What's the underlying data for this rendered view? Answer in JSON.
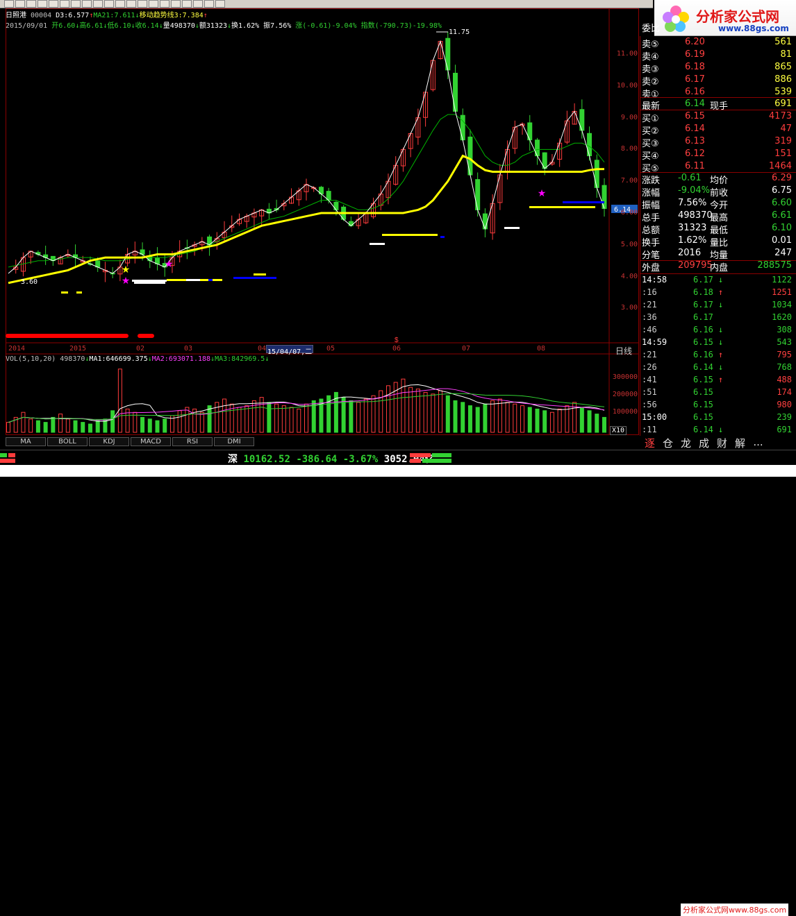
{
  "header": {
    "line1": [
      {
        "text": "日照港",
        "color": "#ffffff"
      },
      {
        "text": " 00004",
        "color": "#c0c0c0"
      },
      {
        "text": " D3:6.577",
        "color": "#ffffff"
      },
      {
        "text": "↑",
        "color": "#ff4040"
      },
      {
        "text": "MA21:7.611",
        "color": "#32d232"
      },
      {
        "text": "↓",
        "color": "#32d232"
      },
      {
        "text": "移动趋势线3:7.384",
        "color": "#ffff40"
      },
      {
        "text": "↑",
        "color": "#ff4040"
      }
    ],
    "line2": [
      {
        "text": "2015/09/01",
        "color": "#c0c0c0"
      },
      {
        "text": " 开6.60",
        "color": "#32d232"
      },
      {
        "text": "↓",
        "color": "#32d232"
      },
      {
        "text": "高6.61",
        "color": "#32d232"
      },
      {
        "text": "↓",
        "color": "#32d232"
      },
      {
        "text": "低6.10",
        "color": "#32d232"
      },
      {
        "text": "↓",
        "color": "#32d232"
      },
      {
        "text": "收6.14",
        "color": "#32d232"
      },
      {
        "text": "↓",
        "color": "#32d232"
      },
      {
        "text": "量498370",
        "color": "#ffffff"
      },
      {
        "text": "↓",
        "color": "#32d232"
      },
      {
        "text": "额31323",
        "color": "#ffffff"
      },
      {
        "text": "↓",
        "color": "#32d232"
      },
      {
        "text": "换1.62%",
        "color": "#ffffff"
      },
      {
        "text": " 振7.56%",
        "color": "#ffffff"
      },
      {
        "text": " 涨(-0.61)-9.04%",
        "color": "#32d232"
      },
      {
        "text": " 指数(-790.73)-19.98%",
        "color": "#32d232"
      }
    ]
  },
  "chart_data": {
    "type": "candlestick",
    "y_ticks": [
      "11.00",
      "10.00",
      "9.00",
      "8.00",
      "7.00",
      "6.00",
      "5.00",
      "4.00",
      "3.00"
    ],
    "x_labels": [
      "2014",
      "2015",
      "02",
      "03",
      "04",
      "05",
      "06",
      "07",
      "08"
    ],
    "highlight_date": "15/04/07,二",
    "max_label": "11.75",
    "min_label": "3.60",
    "current_price_tag": "6.14",
    "period_label": "日线",
    "volume_ticks": [
      "300000",
      "200000",
      "100000"
    ],
    "volume_scale": "X10",
    "close_series": [
      4.1,
      4.3,
      4.6,
      4.8,
      4.7,
      4.6,
      4.5,
      4.6,
      4.7,
      4.6,
      4.5,
      4.4,
      4.3,
      4.2,
      4.1,
      4.3,
      4.7,
      4.8,
      4.7,
      4.5,
      4.4,
      4.3,
      4.6,
      4.8,
      4.9,
      5.0,
      5.1,
      5.0,
      5.2,
      5.4,
      5.6,
      5.8,
      5.9,
      6.0,
      6.1,
      6.0,
      6.1,
      6.3,
      6.5,
      6.7,
      6.9,
      6.8,
      6.6,
      6.4,
      6.1,
      5.8,
      5.6,
      5.8,
      6.0,
      6.3,
      6.6,
      7.0,
      7.5,
      8.0,
      8.5,
      9.0,
      9.8,
      10.8,
      11.4,
      10.5,
      9.2,
      8.3,
      7.2,
      6.1,
      5.5,
      6.3,
      7.2,
      8.0,
      8.7,
      8.8,
      8.3,
      7.8,
      7.4,
      7.6,
      8.2,
      8.9,
      9.2,
      8.6,
      7.8,
      6.8,
      6.14
    ],
    "ma21_series": [
      4.3,
      4.35,
      4.4,
      4.45,
      4.5,
      4.5,
      4.55,
      4.55,
      4.6,
      4.6,
      4.6,
      4.6,
      4.55,
      4.5,
      4.5,
      4.5,
      4.55,
      4.6,
      4.6,
      4.6,
      4.6,
      4.6,
      4.65,
      4.7,
      4.75,
      4.8,
      4.9,
      5.0,
      5.1,
      5.2,
      5.3,
      5.4,
      5.5,
      5.6,
      5.7,
      5.8,
      5.85,
      5.9,
      6.0,
      6.1,
      6.2,
      6.3,
      6.4,
      6.4,
      6.4,
      6.3,
      6.2,
      6.1,
      6.1,
      6.15,
      6.25,
      6.45,
      6.7,
      7.0,
      7.4,
      7.8,
      8.2,
      8.6,
      8.95,
      9.1,
      9.1,
      8.9,
      8.6,
      8.2,
      7.8,
      7.6,
      7.5,
      7.5,
      7.6,
      7.8,
      7.9,
      8.0,
      8.0,
      8.0,
      8.0,
      8.1,
      8.2,
      8.2,
      8.1,
      7.9,
      7.6
    ],
    "trend_series": [
      3.8,
      3.85,
      3.9,
      3.95,
      4.0,
      4.05,
      4.1,
      4.15,
      4.2,
      4.3,
      4.4,
      4.5,
      4.55,
      4.6,
      4.6,
      4.6,
      4.6,
      4.6,
      4.6,
      4.65,
      4.7,
      4.7,
      4.7,
      4.75,
      4.8,
      4.85,
      4.9,
      4.95,
      5.0,
      5.1,
      5.2,
      5.3,
      5.4,
      5.5,
      5.6,
      5.65,
      5.7,
      5.75,
      5.8,
      5.85,
      5.9,
      5.95,
      6.0,
      6.0,
      6.0,
      6.0,
      6.0,
      6.0,
      6.0,
      6.0,
      6.0,
      6.0,
      6.0,
      6.0,
      6.05,
      6.1,
      6.2,
      6.4,
      6.7,
      7.0,
      7.4,
      7.8,
      7.7,
      7.5,
      7.35,
      7.3,
      7.3,
      7.3,
      7.3,
      7.3,
      7.3,
      7.3,
      7.3,
      7.3,
      7.3,
      7.3,
      7.3,
      7.3,
      7.35,
      7.38,
      7.384
    ],
    "volume_series": [
      60,
      90,
      120,
      80,
      70,
      60,
      90,
      110,
      80,
      70,
      60,
      50,
      70,
      80,
      130,
      380,
      140,
      120,
      90,
      80,
      70,
      80,
      100,
      130,
      150,
      140,
      120,
      160,
      180,
      200,
      170,
      150,
      160,
      190,
      210,
      180,
      170,
      160,
      150,
      140,
      170,
      190,
      200,
      220,
      240,
      210,
      190,
      180,
      200,
      220,
      250,
      280,
      300,
      320,
      270,
      260,
      240,
      230,
      250,
      220,
      190,
      180,
      160,
      150,
      170,
      190,
      200,
      180,
      170,
      160,
      150,
      140,
      130,
      120,
      140,
      160,
      180,
      150,
      130,
      110,
      90
    ]
  },
  "vol_info": [
    {
      "text": "VOL(5,10,20) 498370",
      "color": "#c0c0c0"
    },
    {
      "text": "↓",
      "color": "#32d232"
    },
    {
      "text": "MA1:646699.375",
      "color": "#ffffff"
    },
    {
      "text": "↓",
      "color": "#32d232"
    },
    {
      "text": "MA2:693071.188",
      "color": "#ff40ff"
    },
    {
      "text": "↓",
      "color": "#32d232"
    },
    {
      "text": "MA3:842969.5",
      "color": "#32d232"
    },
    {
      "text": "↓",
      "color": "#32d232"
    }
  ],
  "tabs": [
    "MA",
    "BOLL",
    "KDJ",
    "MACD",
    "RSI",
    "DMI"
  ],
  "quote_panel": {
    "weibi_label": "委比",
    "asks": [
      {
        "label": "卖⑤",
        "price": "6.20",
        "vol": "561"
      },
      {
        "label": "卖④",
        "price": "6.19",
        "vol": "81"
      },
      {
        "label": "卖③",
        "price": "6.18",
        "vol": "865"
      },
      {
        "label": "卖②",
        "price": "6.17",
        "vol": "886"
      },
      {
        "label": "卖①",
        "price": "6.16",
        "vol": "539"
      }
    ],
    "last": {
      "label": "最新",
      "price": "6.14",
      "label2": "现手",
      "vol": "691"
    },
    "bids": [
      {
        "label": "买①",
        "price": "6.15",
        "vol": "4173"
      },
      {
        "label": "买②",
        "price": "6.14",
        "vol": "47"
      },
      {
        "label": "买③",
        "price": "6.13",
        "vol": "319"
      },
      {
        "label": "买④",
        "price": "6.12",
        "vol": "151"
      },
      {
        "label": "买⑤",
        "price": "6.11",
        "vol": "1464"
      }
    ],
    "stats": [
      {
        "l1": "涨跌",
        "v1": "-0.61",
        "c1": "#32d232",
        "l2": "均价",
        "v2": "6.29",
        "c2": "#ff4040"
      },
      {
        "l1": "涨幅",
        "v1": "-9.04%",
        "c1": "#32d232",
        "l2": "前收",
        "v2": "6.75",
        "c2": "#ffffff"
      },
      {
        "l1": "振幅",
        "v1": "7.56%",
        "c1": "#ffffff",
        "l2": "今开",
        "v2": "6.60",
        "c2": "#32d232"
      },
      {
        "l1": "总手",
        "v1": "498370",
        "c1": "#ffffff",
        "l2": "最高",
        "v2": "6.61",
        "c2": "#32d232"
      },
      {
        "l1": "总额",
        "v1": "31323",
        "c1": "#ffffff",
        "l2": "最低",
        "v2": "6.10",
        "c2": "#32d232"
      },
      {
        "l1": "换手",
        "v1": "1.62%",
        "c1": "#ffffff",
        "l2": "量比",
        "v2": "0.01",
        "c2": "#ffffff"
      },
      {
        "l1": "分笔",
        "v1": "2016",
        "c1": "#ffffff",
        "l2": "均量",
        "v2": "247",
        "c2": "#ffffff"
      }
    ],
    "outer": {
      "l1": "外盘",
      "v1": "209795",
      "l2": "内盘",
      "v2": "288575"
    }
  },
  "ticks": [
    {
      "time": "14:58",
      "price": "6.17",
      "dir": "↓",
      "vol": "1122",
      "pc": "#32d232",
      "vc": "#32d232"
    },
    {
      "time": ":16",
      "price": "6.18",
      "dir": "↑",
      "vol": "1251",
      "pc": "#32d232",
      "vc": "#ff4040"
    },
    {
      "time": ":21",
      "price": "6.17",
      "dir": "↓",
      "vol": "1034",
      "pc": "#32d232",
      "vc": "#32d232"
    },
    {
      "time": ":36",
      "price": "6.17",
      "dir": "",
      "vol": "1620",
      "pc": "#32d232",
      "vc": "#32d232"
    },
    {
      "time": ":46",
      "price": "6.16",
      "dir": "↓",
      "vol": "308",
      "pc": "#32d232",
      "vc": "#32d232"
    },
    {
      "time": "14:59",
      "price": "6.15",
      "dir": "↓",
      "vol": "543",
      "pc": "#32d232",
      "vc": "#32d232"
    },
    {
      "time": ":21",
      "price": "6.16",
      "dir": "↑",
      "vol": "795",
      "pc": "#32d232",
      "vc": "#ff4040"
    },
    {
      "time": ":26",
      "price": "6.14",
      "dir": "↓",
      "vol": "768",
      "pc": "#32d232",
      "vc": "#32d232"
    },
    {
      "time": ":41",
      "price": "6.15",
      "dir": "↑",
      "vol": "488",
      "pc": "#32d232",
      "vc": "#ff4040"
    },
    {
      "time": ":51",
      "price": "6.15",
      "dir": "",
      "vol": "174",
      "pc": "#32d232",
      "vc": "#ff4040"
    },
    {
      "time": ":56",
      "price": "6.15",
      "dir": "",
      "vol": "980",
      "pc": "#32d232",
      "vc": "#ff4040"
    },
    {
      "time": "15:00",
      "price": "6.15",
      "dir": "",
      "vol": "239",
      "pc": "#32d232",
      "vc": "#32d232"
    },
    {
      "time": ":11",
      "price": "6.14",
      "dir": "↓",
      "vol": "691",
      "pc": "#32d232",
      "vc": "#32d232"
    }
  ],
  "bottom_tabs": [
    "逐",
    "仓",
    "龙",
    "成",
    "财",
    "解",
    "..."
  ],
  "status": {
    "index_name": "深",
    "index_value": "10162.52",
    "change": "-386.64",
    "percent": "-3.67%",
    "amount": "3052.04亿"
  },
  "branding": {
    "logo_cn": "分析家公式网",
    "logo_url": "www.88gs.com",
    "footer": "分析家公式网www.88gs.com"
  },
  "colors": {
    "up": "#ff3c3c",
    "down": "#32d232",
    "trend": "#ffff00",
    "ma": "#ffffff",
    "ma21": "#00b400"
  }
}
